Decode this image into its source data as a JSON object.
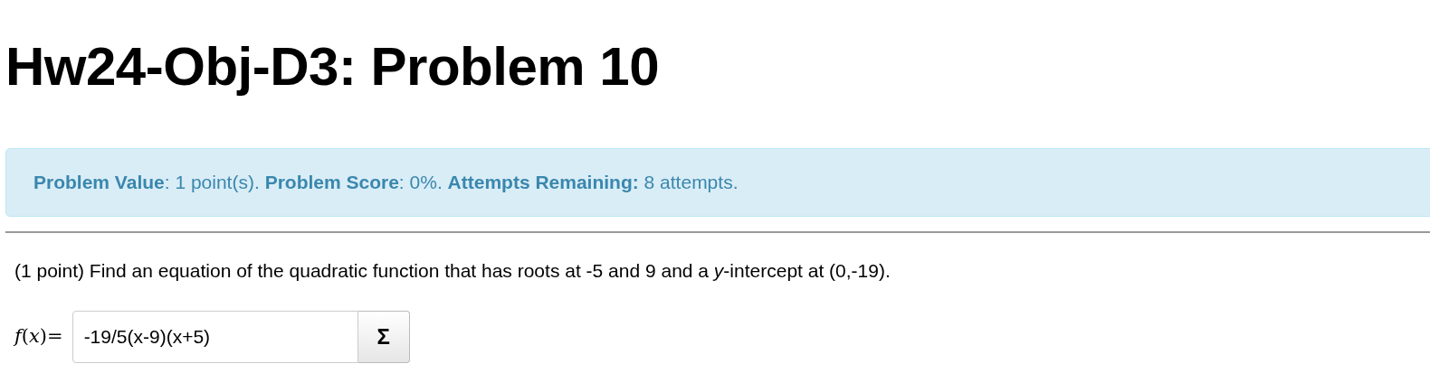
{
  "title": "Hw24-Obj-D3: Problem 10",
  "info": "**Problem Value**: 1 point(s). **Problem Score**: 0%. **Attempts Remaining:** 8 attempts.",
  "problem": "(1 point) Find an equation of the quadratic function that has roots at -5 and 9 and a *y*-intercept at (0,-19).",
  "answer": {
    "label": "*f*(*x*)=",
    "value": "-19/5(x-9)(x+5)",
    "button": "Σ"
  }
}
